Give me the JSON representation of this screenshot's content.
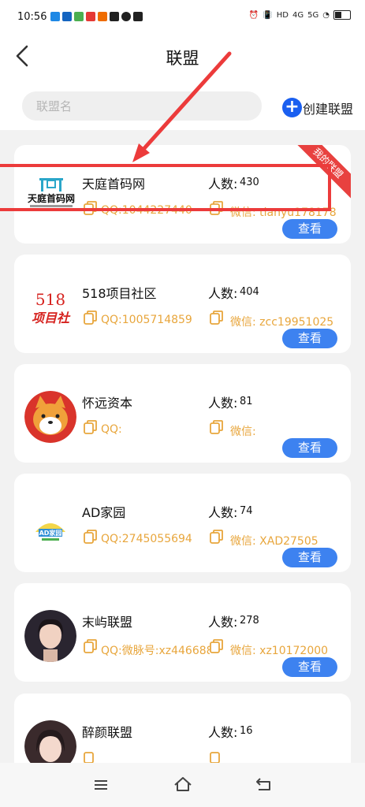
{
  "status_bar": {
    "time": "10:56",
    "net_a": "4G",
    "net_b": "5G",
    "hd": "HD",
    "icon_colors": [
      "#1e88e5",
      "#1565c0",
      "#4caf50",
      "#e53935",
      "#ef6c00",
      "#212121",
      "#212121",
      "#212121"
    ]
  },
  "header": {
    "title": "联盟",
    "search_placeholder": "联盟名",
    "create_label": "创建联盟",
    "create_icon": "plus-icon"
  },
  "labels": {
    "count": "人数:",
    "view": "查看",
    "my_badge": "我的联盟"
  },
  "alliances": [
    {
      "name": "天庭首码网",
      "count": "430",
      "qq": "QQ:1044227440",
      "wechat": "微信: tianyu178178",
      "logo": "tianting-logo",
      "logo_text": "天庭首码网"
    },
    {
      "name": "518项目社区",
      "count": "404",
      "qq": "QQ:1005714859",
      "wechat": "微信: zcc19951025",
      "logo": "518-logo",
      "logo_text_top": "518",
      "logo_text_bottom": "项目社"
    },
    {
      "name": "怀远资本",
      "count": "81",
      "qq": "QQ:",
      "wechat": "微信:",
      "logo": "shiba-dog-avatar"
    },
    {
      "name": "AD家园",
      "count": "74",
      "qq": "QQ:2745055694",
      "wechat": "微信: XAD27505",
      "logo": "ad-home-logo",
      "logo_text": "AD家园"
    },
    {
      "name": "末屿联盟",
      "count": "278",
      "qq": "QQ:微脉号:xz446688",
      "wechat": "微信: xz10172000",
      "logo": "girl-avatar"
    },
    {
      "name": "醉颜联盟",
      "count": "16",
      "qq": "",
      "wechat": "",
      "logo": "girl-avatar-2"
    }
  ],
  "colors": {
    "accent_blue": "#3d82f0",
    "create_blue": "#1a5ff0",
    "contact_orange": "#e8a63c",
    "badge_red": "#e8413f",
    "annotation_red": "#ec3b3b"
  },
  "nav": {
    "menu_icon": "menu-icon",
    "home_icon": "home-icon",
    "back_icon": "back-nav-icon"
  }
}
